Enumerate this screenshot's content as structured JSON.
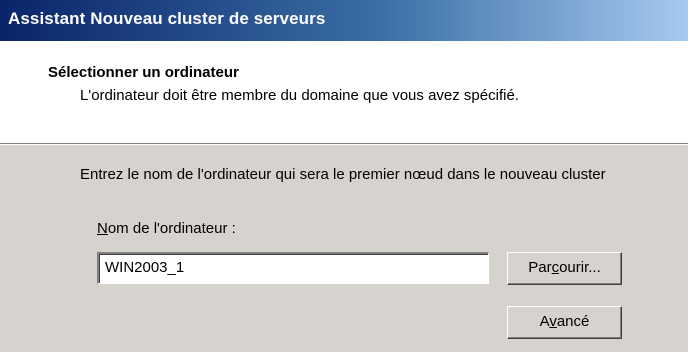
{
  "window": {
    "title": "Assistant Nouveau cluster de serveurs"
  },
  "header": {
    "title": "Sélectionner un ordinateur",
    "subtitle": "L'ordinateur doit être membre du domaine que vous avez spécifié."
  },
  "body": {
    "instruction": "Entrez le nom de l'ordinateur qui sera le premier nœud dans le nouveau cluster",
    "computer_name_label": {
      "accel": "N",
      "rest": "om de l'ordinateur :"
    },
    "computer_name_value": "WIN2003_1",
    "browse_button": {
      "before": "Par",
      "accel": "c",
      "after": "ourir..."
    },
    "advanced_button": {
      "before": "A",
      "accel": "v",
      "after": "ancé"
    }
  },
  "colors": {
    "title_gradient_start": "#0a246a",
    "title_gradient_end": "#a6caf0",
    "dialog_face": "#d6d3ce",
    "header_background": "#ffffff"
  }
}
